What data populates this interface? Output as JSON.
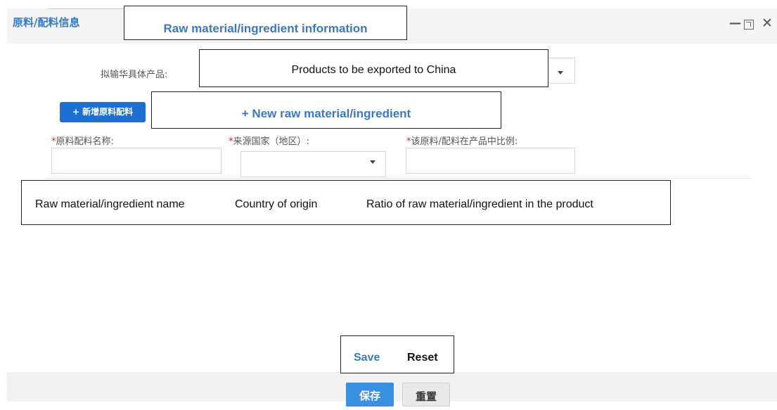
{
  "dialog": {
    "title": "原料/配料信息",
    "title_translation": "Raw material/ingredient information"
  },
  "product": {
    "label": "拟输华具体产品:",
    "translation": "Products to be exported to China",
    "value": ""
  },
  "add_button": {
    "label": "+ 新增原料配料",
    "translation": "+ New raw material/ingredient"
  },
  "fields": {
    "name": {
      "required_mark": "*",
      "label": "原料配料名称:",
      "value": ""
    },
    "country": {
      "required_mark": "*",
      "label": "来源国家（地区）:",
      "value": ""
    },
    "ratio": {
      "required_mark": "*",
      "label": "该原料/配料在产品中比例:",
      "value": ""
    }
  },
  "column_translations": {
    "name": "Raw material/ingredient name",
    "country": "Country of origin",
    "ratio": "Ratio of raw material/ingredient in the product"
  },
  "footer": {
    "save_label": "保存",
    "reset_label": "重置",
    "save_translation": "Save",
    "reset_translation": "Reset"
  },
  "window_controls": {
    "minimize_glyph": "—",
    "close_glyph": "✕"
  },
  "colors": {
    "accent": "#3a78c4",
    "primary_button": "#1e6fd3",
    "required": "#e02020"
  }
}
